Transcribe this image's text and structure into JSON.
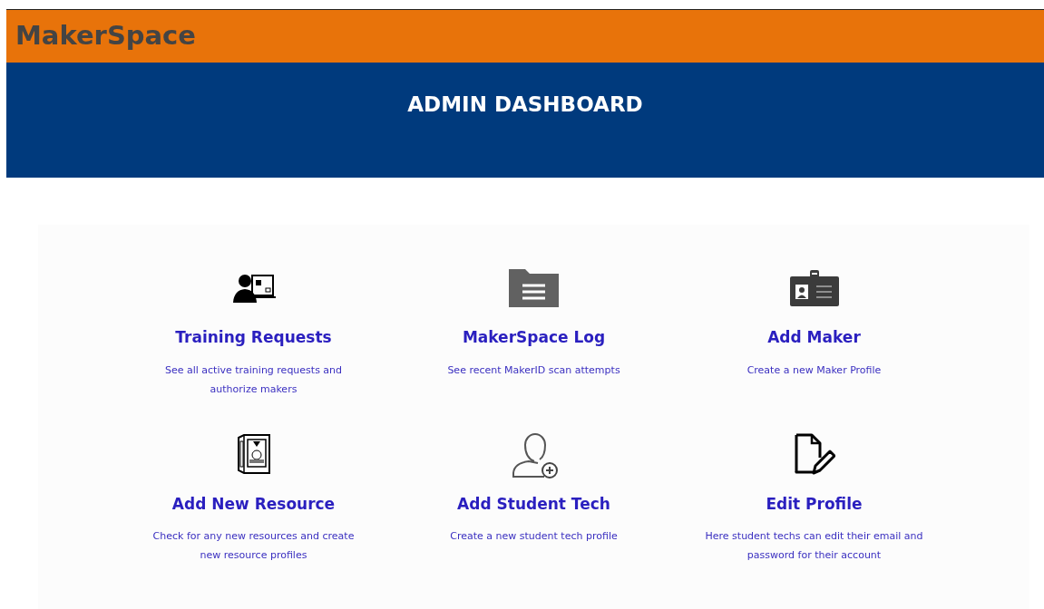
{
  "brand": "MakerSpace",
  "header": {
    "title": "ADMIN DASHBOARD"
  },
  "cards": [
    {
      "title": "Training Requests",
      "description": "See all active training requests and authorize makers"
    },
    {
      "title": "MakerSpace Log",
      "description": "See recent MakerID scan attempts"
    },
    {
      "title": "Add Maker",
      "description": "Create a new Maker Profile"
    },
    {
      "title": "Add New Resource",
      "description": "Check for any new resources and create new resource profiles"
    },
    {
      "title": "Add Student Tech",
      "description": "Create a new student tech profile"
    },
    {
      "title": "Edit Profile",
      "description": "Here student techs can edit their email and password for their account"
    }
  ]
}
